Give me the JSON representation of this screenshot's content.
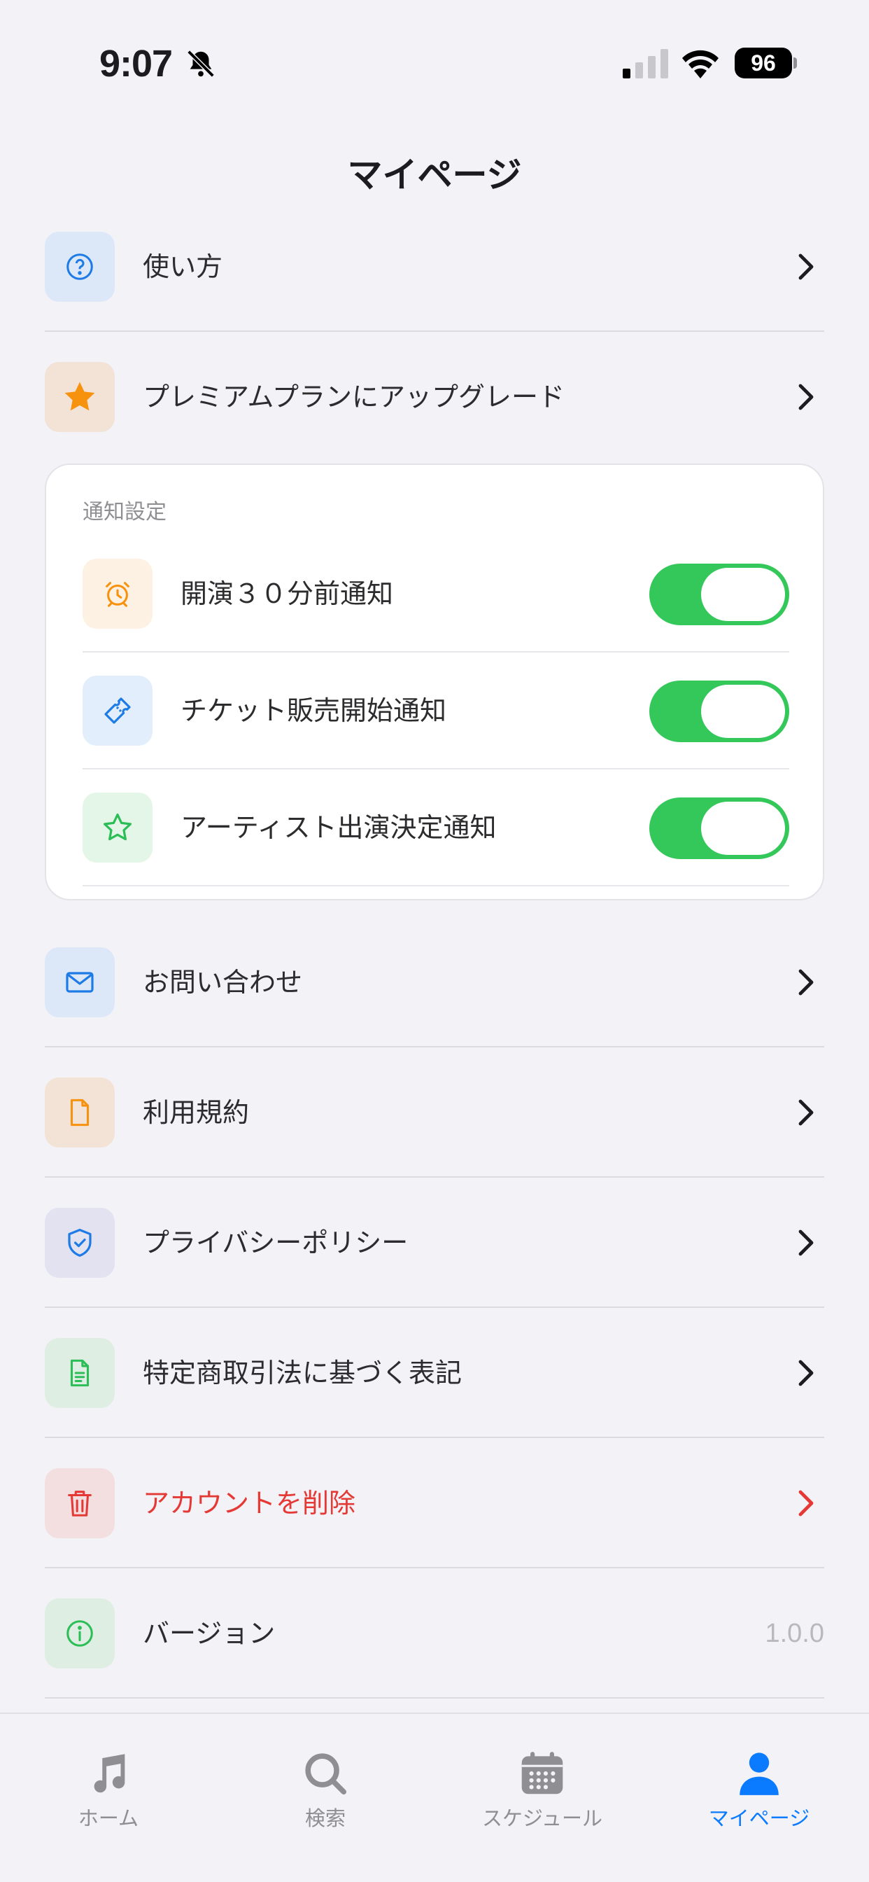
{
  "status_bar": {
    "time": "9:07",
    "battery": "96"
  },
  "page": {
    "title": "マイページ"
  },
  "menu_top": [
    {
      "label": "使い方",
      "icon": "help-circle-icon"
    },
    {
      "label": "プレミアムプランにアップグレード",
      "icon": "star-icon"
    }
  ],
  "notifications": {
    "title": "通知設定",
    "items": [
      {
        "label": "開演３０分前通知",
        "icon": "alarm-icon",
        "enabled": true
      },
      {
        "label": "チケット販売開始通知",
        "icon": "ticket-icon",
        "enabled": true
      },
      {
        "label": "アーティスト出演決定通知",
        "icon": "star-outline-icon",
        "enabled": true
      }
    ]
  },
  "menu_bottom": [
    {
      "label": "お問い合わせ",
      "icon": "mail-icon"
    },
    {
      "label": "利用規約",
      "icon": "document-icon"
    },
    {
      "label": "プライバシーポリシー",
      "icon": "shield-check-icon"
    },
    {
      "label": "特定商取引法に基づく表記",
      "icon": "document-text-icon"
    },
    {
      "label": "アカウントを削除",
      "icon": "trash-icon",
      "color": "#e53935"
    },
    {
      "label": "バージョン",
      "icon": "info-icon",
      "value": "1.0.0"
    }
  ],
  "tabs": [
    {
      "label": "ホーム",
      "icon": "music-note-icon",
      "active": false
    },
    {
      "label": "検索",
      "icon": "search-icon",
      "active": false
    },
    {
      "label": "スケジュール",
      "icon": "calendar-icon",
      "active": false
    },
    {
      "label": "マイページ",
      "icon": "person-icon",
      "active": true
    }
  ],
  "colors": {
    "accent": "#0a7aff",
    "toggle_on": "#34c759",
    "danger": "#e53935",
    "background": "#f2f2f7"
  }
}
